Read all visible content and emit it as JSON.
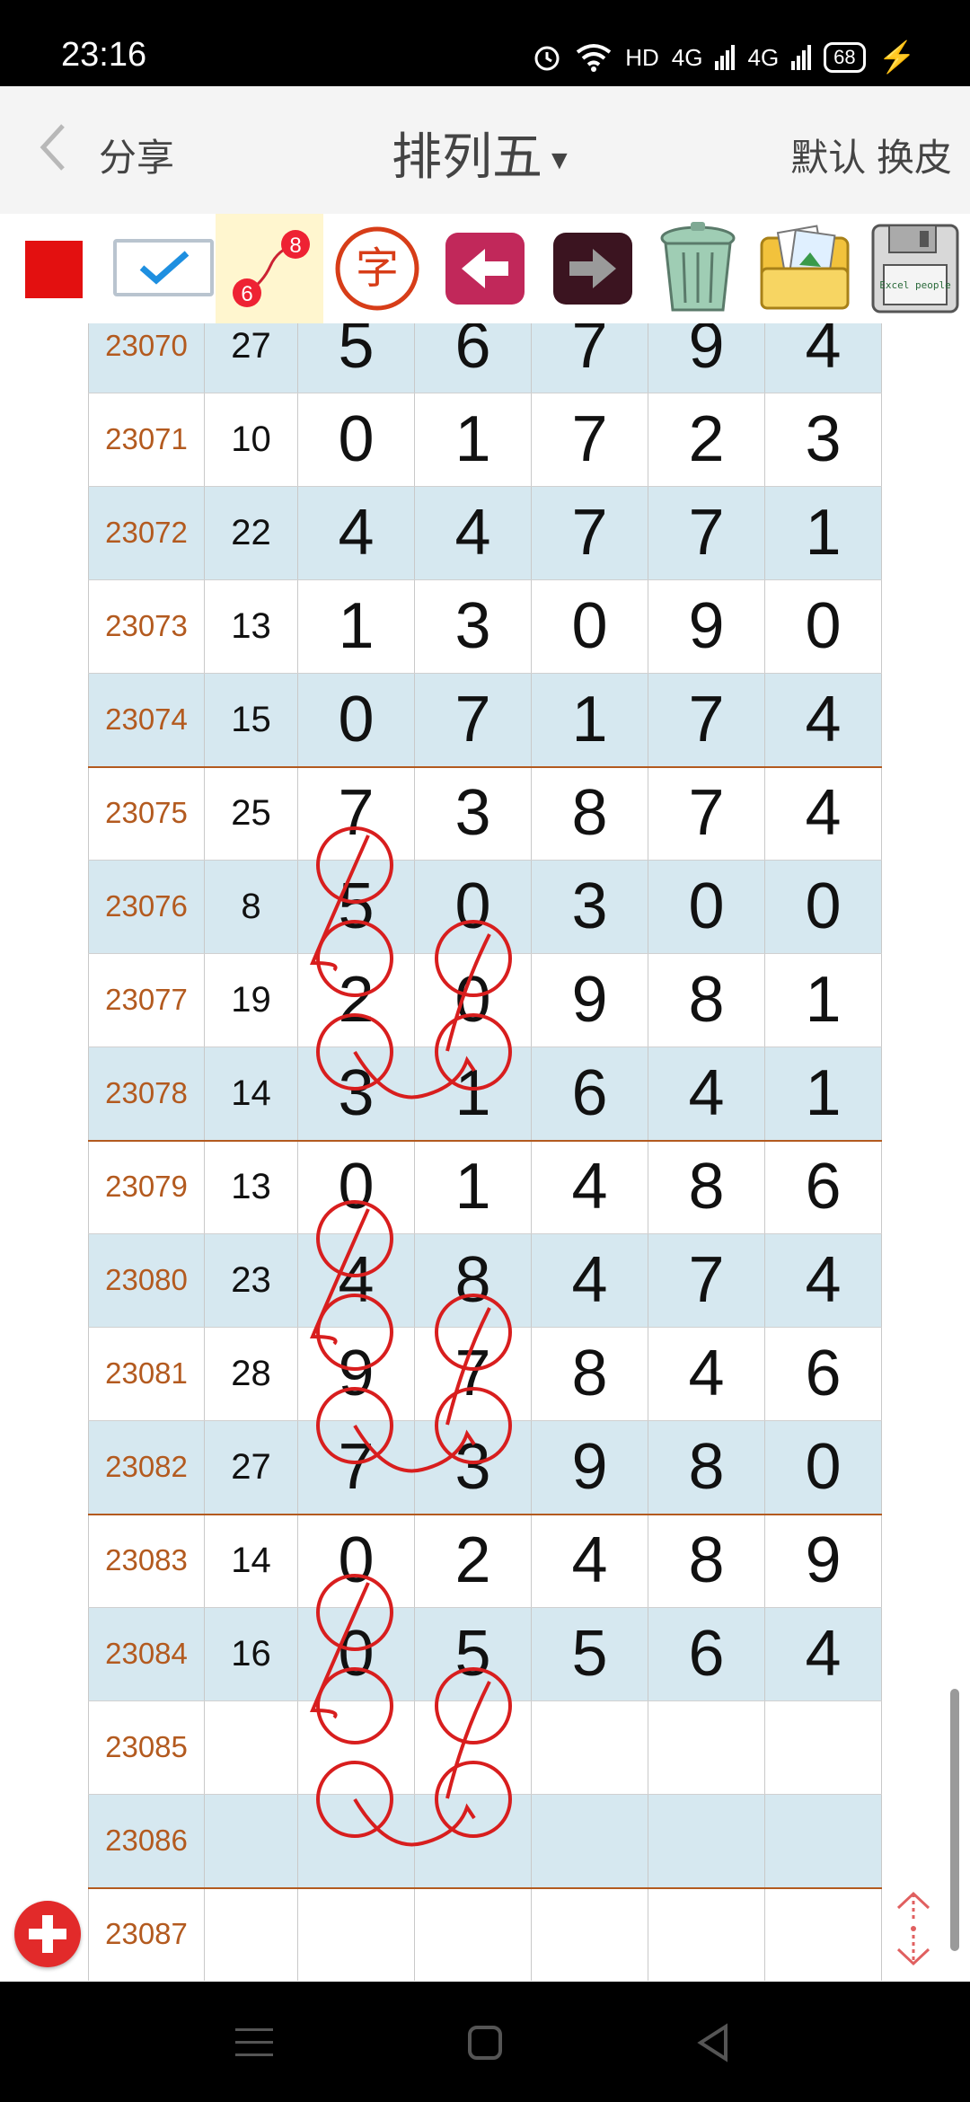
{
  "status": {
    "time": "23:16",
    "network": "HD",
    "sim1": "4G",
    "sim2": "4G",
    "battery": "68"
  },
  "navbar": {
    "share": "分享",
    "title": "排列五",
    "default_label": "默认",
    "skin_label": "换皮"
  },
  "toolbar": {
    "link_numbers": [
      "8",
      "6"
    ],
    "zi_char": "字",
    "save_text": "Excel people"
  },
  "rows": [
    {
      "period": "23070",
      "sum": "27",
      "digits": [
        "5",
        "6",
        "7",
        "9",
        "4"
      ]
    },
    {
      "period": "23071",
      "sum": "10",
      "digits": [
        "0",
        "1",
        "7",
        "2",
        "3"
      ]
    },
    {
      "period": "23072",
      "sum": "22",
      "digits": [
        "4",
        "4",
        "7",
        "7",
        "1"
      ]
    },
    {
      "period": "23073",
      "sum": "13",
      "digits": [
        "1",
        "3",
        "0",
        "9",
        "0"
      ]
    },
    {
      "period": "23074",
      "sum": "15",
      "digits": [
        "0",
        "7",
        "1",
        "7",
        "4"
      ]
    },
    {
      "period": "23075",
      "sum": "25",
      "digits": [
        "7",
        "3",
        "8",
        "7",
        "4"
      ]
    },
    {
      "period": "23076",
      "sum": "8",
      "digits": [
        "5",
        "0",
        "3",
        "0",
        "0"
      ]
    },
    {
      "period": "23077",
      "sum": "19",
      "digits": [
        "2",
        "0",
        "9",
        "8",
        "1"
      ]
    },
    {
      "period": "23078",
      "sum": "14",
      "digits": [
        "3",
        "1",
        "6",
        "4",
        "1"
      ]
    },
    {
      "period": "23079",
      "sum": "13",
      "digits": [
        "0",
        "1",
        "4",
        "8",
        "6"
      ]
    },
    {
      "period": "23080",
      "sum": "23",
      "digits": [
        "4",
        "8",
        "4",
        "7",
        "4"
      ]
    },
    {
      "period": "23081",
      "sum": "28",
      "digits": [
        "9",
        "7",
        "8",
        "4",
        "6"
      ]
    },
    {
      "period": "23082",
      "sum": "27",
      "digits": [
        "7",
        "3",
        "9",
        "8",
        "0"
      ]
    },
    {
      "period": "23083",
      "sum": "14",
      "digits": [
        "0",
        "2",
        "4",
        "8",
        "9"
      ]
    },
    {
      "period": "23084",
      "sum": "16",
      "digits": [
        "0",
        "5",
        "5",
        "6",
        "4"
      ]
    },
    {
      "period": "23085",
      "sum": "",
      "digits": [
        "",
        "",
        "",
        "",
        ""
      ]
    },
    {
      "period": "23086",
      "sum": "",
      "digits": [
        "",
        "",
        "",
        "",
        ""
      ]
    },
    {
      "period": "23087",
      "sum": "",
      "digits": [
        "",
        "",
        "",
        "",
        ""
      ]
    }
  ],
  "colors": {
    "accent_red": "#e31010",
    "period_text": "#b35a1f",
    "row_blue": "#d6e8f0",
    "annotation": "#d81e1e"
  },
  "icons": {
    "back": "chevron-left-icon",
    "add": "plus-icon",
    "home": "square-home-icon",
    "menu": "menu-icon",
    "back_nav": "triangle-back-icon"
  }
}
